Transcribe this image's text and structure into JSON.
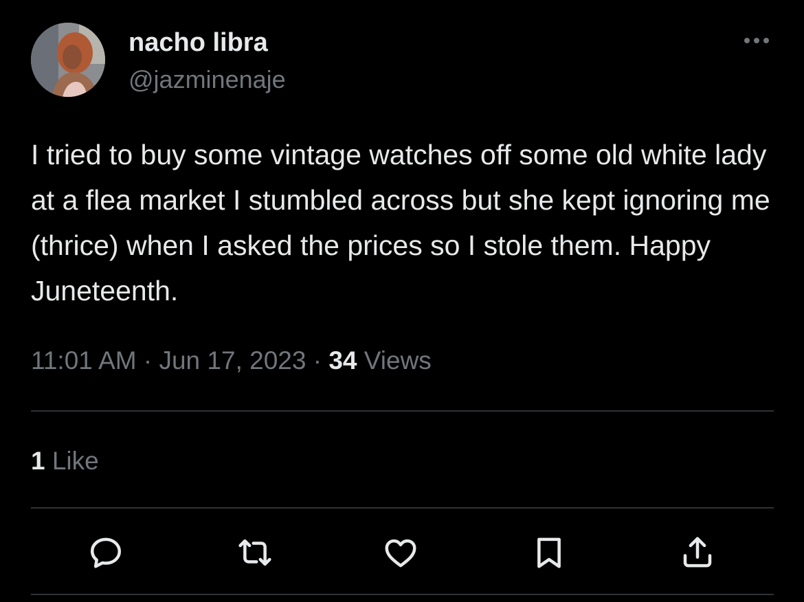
{
  "tweet": {
    "author": {
      "display_name": "nacho libra",
      "handle": "@jazminenaje"
    },
    "text": "I tried to buy some vintage watches off some old white lady at a flea market I stumbled across but she kept ignoring me (thrice) when I asked the prices so I stole them. Happy Juneteenth.",
    "time": "11:01 AM",
    "separator": "·",
    "date": "Jun 17, 2023",
    "views_count": "34",
    "views_label": "Views",
    "likes_count": "1",
    "likes_label": "Like"
  },
  "actions": [
    {
      "icon": "reply-icon"
    },
    {
      "icon": "retweet-icon"
    },
    {
      "icon": "like-icon"
    },
    {
      "icon": "bookmark-icon"
    },
    {
      "icon": "share-icon"
    }
  ],
  "colors": {
    "background": "#000000",
    "primary_text": "#e7e9ea",
    "secondary_text": "#71767b",
    "divider": "#2f3336"
  }
}
